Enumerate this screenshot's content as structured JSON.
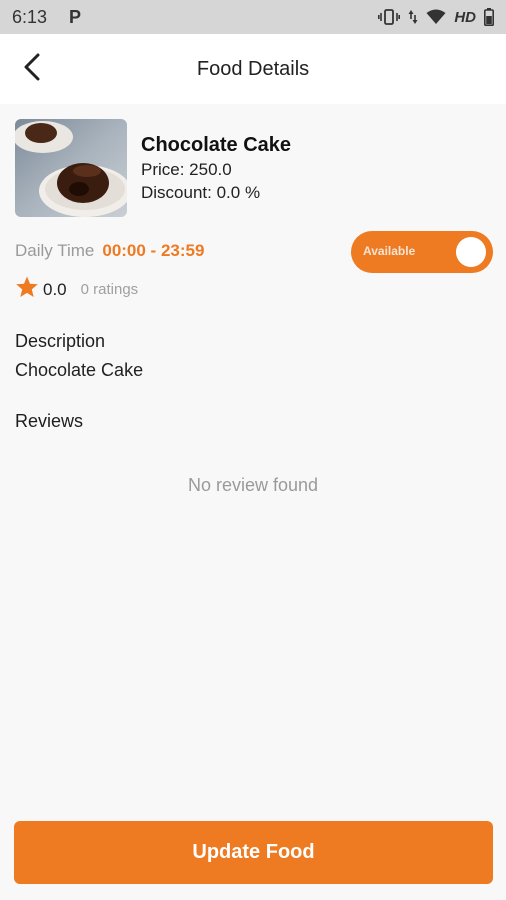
{
  "status_bar": {
    "time": "6:13",
    "app_indicator": "P",
    "network": "HD",
    "icons": [
      "vibrate-icon",
      "data-arrows-icon",
      "wifi-icon",
      "battery-icon"
    ]
  },
  "header": {
    "title": "Food Details",
    "back_icon": "back-arrow-icon"
  },
  "food": {
    "name": "Chocolate Cake",
    "price": "Price: 250.0",
    "discount": "Discount: 0.0 %",
    "image_icon": "food-photo"
  },
  "availability": {
    "daily_time_label": "Daily Time",
    "daily_time_value": "00:00 - 23:59",
    "toggle_label": "Available",
    "toggle_on": true
  },
  "rating": {
    "value": "0.0",
    "count": "0 ratings",
    "star_icon": "star-icon"
  },
  "description": {
    "title": "Description",
    "text": "Chocolate Cake"
  },
  "reviews": {
    "title": "Reviews",
    "empty_text": "No review found"
  },
  "footer": {
    "update_label": "Update Food"
  },
  "colors": {
    "accent": "#ee7a22",
    "status_bar": "#d6d6d6",
    "background": "#f8f8f8"
  }
}
